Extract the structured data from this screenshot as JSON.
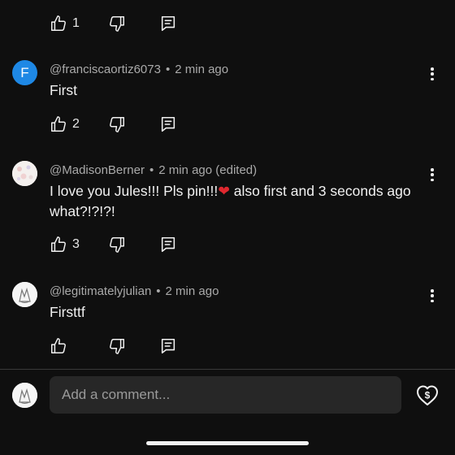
{
  "comments_top": {
    "likes": "1"
  },
  "comments": [
    {
      "avatar_letter": "F",
      "username": "@franciscaortiz6073",
      "time": "2 min ago",
      "edited": "",
      "text": "First",
      "likes": "2"
    },
    {
      "username": "@MadisonBerner",
      "time": "2 min ago",
      "edited": "(edited)",
      "text_before_emoji": "I love you Jules!!! Pls pin!!!",
      "emoji": "❤",
      "text_after_emoji": " also first and 3 seconds ago what?!?!?!",
      "likes": "3"
    },
    {
      "username": "@legitimatelyjulian",
      "time": "2 min ago",
      "edited": "",
      "text": "Firsttf",
      "likes": ""
    }
  ],
  "composer": {
    "placeholder": "Add a comment..."
  },
  "colors": {
    "background": "#0f0f0f",
    "avatar_f": "#1e88e5",
    "heart": "#e0282f"
  },
  "icons": [
    "thumb-up-icon",
    "thumb-down-icon",
    "reply-icon",
    "more-vert-icon",
    "super-thanks-icon"
  ]
}
